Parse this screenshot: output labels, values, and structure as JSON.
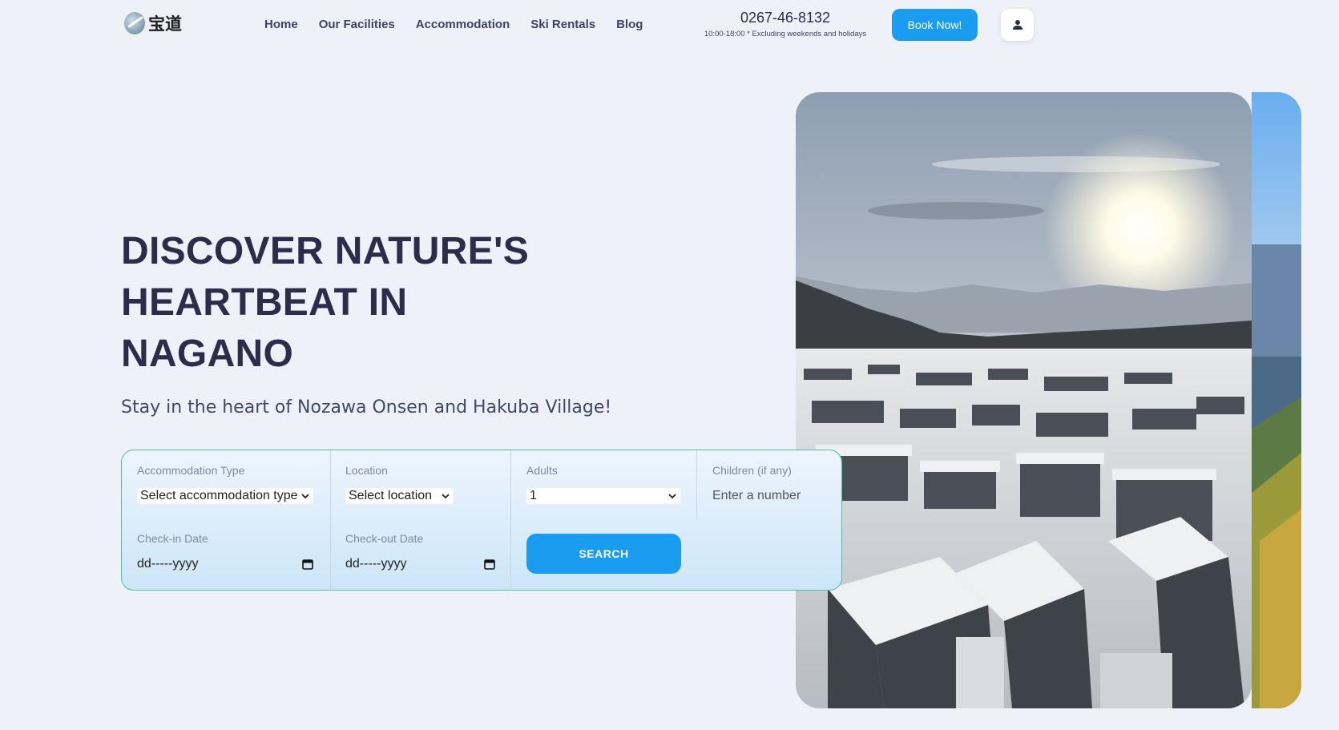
{
  "header": {
    "logo_text": "宝道",
    "nav": [
      "Home",
      "Our Facilities",
      "Accommodation",
      "Ski Rentals",
      "Blog"
    ],
    "phone": "0267-46-8132",
    "hours": "10:00-18:00 * Excluding weekends and holidays",
    "book_label": "Book Now!",
    "user_icon": "user-icon"
  },
  "hero": {
    "title_line1": "DISCOVER NATURE'S",
    "title_line2": "HEARTBEAT IN",
    "title_line3": "NAGANO",
    "subtitle": "Stay in the heart of Nozawa Onsen and Hakuba Village!"
  },
  "search": {
    "accommodation_label": "Accommodation Type",
    "accommodation_value": "Select accommodation type",
    "location_label": "Location",
    "location_value": "Select location",
    "adults_label": "Adults",
    "adults_value": "1",
    "children_label": "Children (if any)",
    "children_placeholder": "Enter a number",
    "checkin_label": "Check-in Date",
    "checkin_value": "dd-----yyyy",
    "checkout_label": "Check-out Date",
    "checkout_value": "dd-----yyyy",
    "search_label": "SEARCH"
  },
  "colors": {
    "accent": "#1a9cf0",
    "heading": "#2b2d4a",
    "border": "#4dbf9f",
    "background": "#eef1f8"
  }
}
